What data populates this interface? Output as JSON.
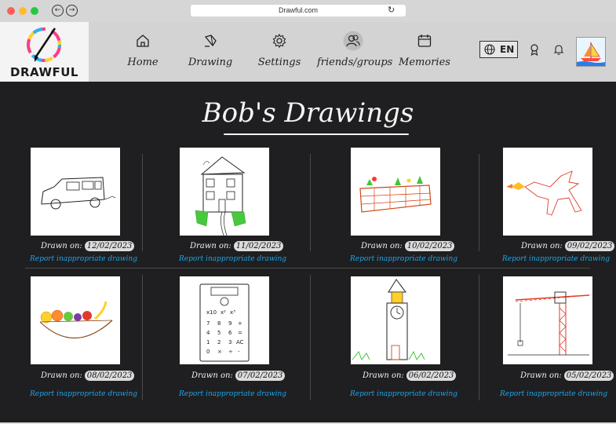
{
  "browser": {
    "url": "Drawful.com"
  },
  "header": {
    "logo_text": "DRAWFUL",
    "nav": [
      {
        "label": "Home",
        "icon": "home-icon"
      },
      {
        "label": "Drawing",
        "icon": "pen-icon"
      },
      {
        "label": "Settings",
        "icon": "gear-icon"
      },
      {
        "label": "friends/groups",
        "icon": "users-icon"
      },
      {
        "label": "Memories",
        "icon": "calendar-icon"
      }
    ],
    "language": "EN",
    "colors": {
      "header_bg": "#d3d3d3",
      "content_bg": "#1f1f21",
      "link": "#1aa7ec"
    }
  },
  "main": {
    "title": "Bob's Drawings",
    "drawn_label": "Drawn on:",
    "report_label": "Report inappropriate drawing",
    "drawings": [
      {
        "subject": "car",
        "date": "12/02/2023"
      },
      {
        "subject": "house",
        "date": "11/02/2023"
      },
      {
        "subject": "planter",
        "date": "10/02/2023"
      },
      {
        "subject": "dragon",
        "date": "09/02/2023"
      },
      {
        "subject": "fruit-bowl",
        "date": "08/02/2023"
      },
      {
        "subject": "calculator",
        "date": "07/02/2023"
      },
      {
        "subject": "clock-tower",
        "date": "06/02/2023"
      },
      {
        "subject": "crane",
        "date": "05/02/2023"
      }
    ]
  }
}
